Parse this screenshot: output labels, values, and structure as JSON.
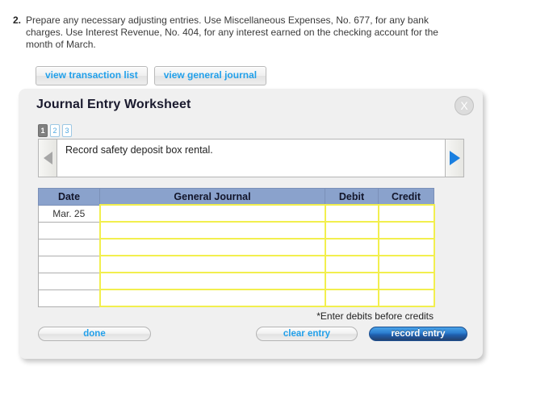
{
  "question": {
    "number": "2.",
    "text": "Prepare any necessary adjusting entries. Use Miscellaneous Expenses, No. 677, for any bank charges. Use Interest Revenue, No. 404, for any interest earned on the checking account for the month of March."
  },
  "view_buttons": [
    {
      "label": "view transaction list"
    },
    {
      "label": "view general journal"
    }
  ],
  "panel": {
    "title": "Journal Entry Worksheet",
    "close_label": "X",
    "close_icon": "close-circle-icon",
    "pager": [
      {
        "label": "1",
        "active": true
      },
      {
        "label": "2",
        "active": false
      },
      {
        "label": "3",
        "active": false
      }
    ],
    "nav": {
      "prev_icon": "triangle-left-icon",
      "next_icon": "triangle-right-icon"
    },
    "prompt": "Record safety deposit box rental.",
    "table": {
      "headers": [
        "Date",
        "General Journal",
        "Debit",
        "Credit"
      ],
      "rows": [
        {
          "date": "Mar. 25",
          "general_journal": "",
          "debit": "",
          "credit": ""
        },
        {
          "date": "",
          "general_journal": "",
          "debit": "",
          "credit": ""
        },
        {
          "date": "",
          "general_journal": "",
          "debit": "",
          "credit": ""
        },
        {
          "date": "",
          "general_journal": "",
          "debit": "",
          "credit": ""
        },
        {
          "date": "",
          "general_journal": "",
          "debit": "",
          "credit": ""
        },
        {
          "date": "",
          "general_journal": "",
          "debit": "",
          "credit": ""
        }
      ]
    },
    "note": "*Enter debits before credits",
    "footer": {
      "done": "done",
      "clear_entry": "clear entry",
      "record_entry": "record entry"
    }
  },
  "colors": {
    "link_blue": "#22a0ea",
    "table_header_blue": "#8aa2cc",
    "input_border_yellow": "#f2ef4e",
    "record_button_blue": "#2d7fd0",
    "panel_background": "#f0f0f0",
    "active_tab_gray": "#808080"
  }
}
